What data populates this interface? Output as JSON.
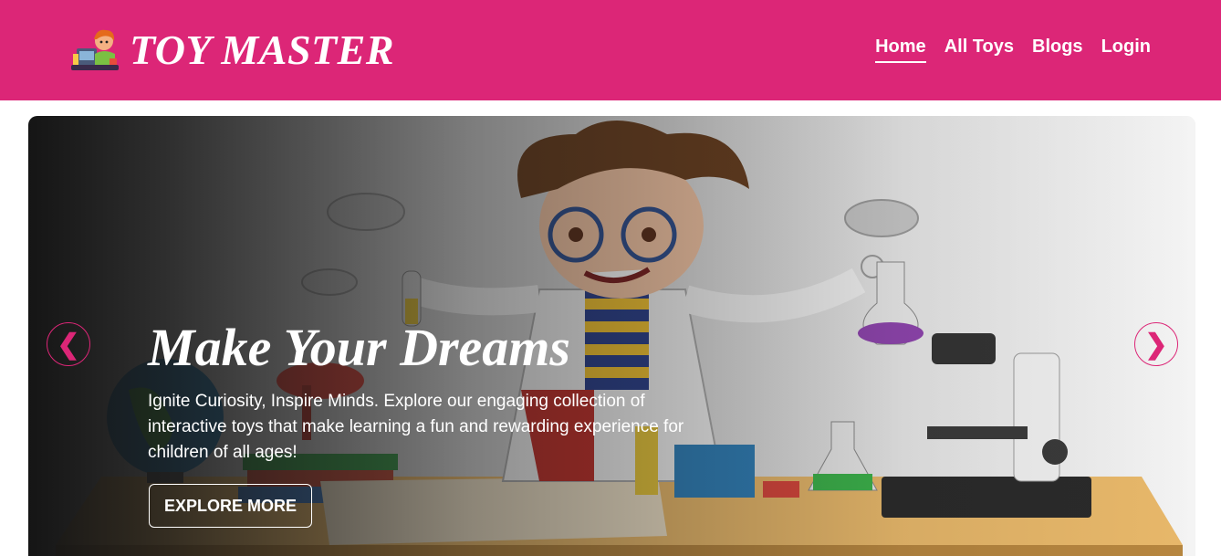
{
  "brand": {
    "name": "TOY MASTER",
    "logo_icon": "toy-maker-logo-icon"
  },
  "nav": {
    "items": [
      {
        "label": "Home",
        "active": true
      },
      {
        "label": "All Toys",
        "active": false
      },
      {
        "label": "Blogs",
        "active": false
      },
      {
        "label": "Login",
        "active": false
      }
    ]
  },
  "hero": {
    "title": "Make Your Dreams",
    "description": "Ignite Curiosity, Inspire Minds. Explore our engaging collection of interactive toys that make learning a fun and rewarding experience for children of all ages!",
    "cta_label": "EXPLORE MORE",
    "prev_glyph": "❮",
    "next_glyph": "❯"
  },
  "colors": {
    "brand_pink": "#dc2677",
    "white": "#ffffff",
    "overlay": "#151515"
  }
}
